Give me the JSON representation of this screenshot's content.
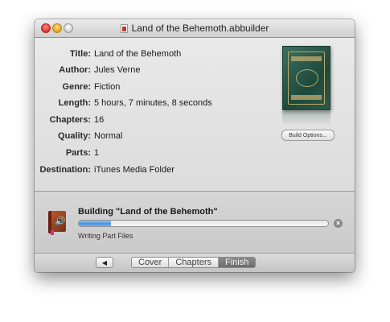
{
  "window": {
    "title": "Land of the Behemoth.abbuilder"
  },
  "info": {
    "rows": [
      {
        "label": "Title:",
        "value": "Land of the Behemoth"
      },
      {
        "label": "Author:",
        "value": "Jules Verne"
      },
      {
        "label": "Genre:",
        "value": "Fiction"
      },
      {
        "label": "Length:",
        "value": "5 hours, 7 minutes, 8 seconds"
      },
      {
        "label": "Chapters:",
        "value": "16"
      },
      {
        "label": "Quality:",
        "value": "Normal"
      },
      {
        "label": "Parts:",
        "value": "1"
      },
      {
        "label": "Destination:",
        "value": "iTunes Media Folder"
      }
    ],
    "build_options_label": "Build Options..."
  },
  "progress": {
    "title": "Building \"Land of the Behemoth\"",
    "status": "Writing Part Files",
    "fraction": 0.13
  },
  "toolbar": {
    "back_label": "◀",
    "segments": [
      {
        "label": "Cover",
        "active": false
      },
      {
        "label": "Chapters",
        "active": false
      },
      {
        "label": "Finish",
        "active": true
      }
    ]
  },
  "colors": {
    "progress_fill": "#4a8fdd",
    "active_segment": "#6c6c6c"
  }
}
